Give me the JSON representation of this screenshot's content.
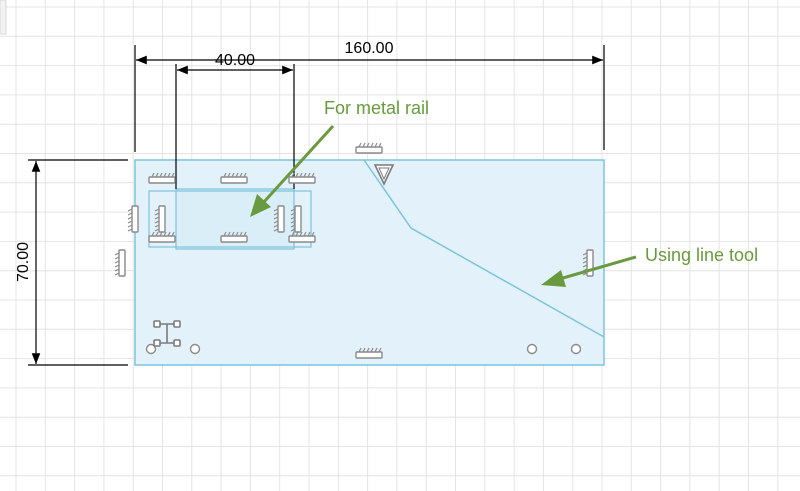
{
  "sketch": {
    "dimensions": {
      "overall_width": "160.00",
      "rail_width": "40.00",
      "height": "70.00"
    },
    "annotations": {
      "rail_note": "For metal rail",
      "line_note": "Using line tool"
    },
    "colors": {
      "annotation": "#6a9a3f",
      "sketch_line": "#7cc4dd",
      "profile_fill": "#e3f2fa",
      "grid": "#e4e4e4",
      "constraint_glyph": "#8a8a8a"
    },
    "constraint_icons": [
      "horizontal-constraint-icon",
      "vertical-constraint-icon",
      "coincident-point-icon",
      "midpoint-triangle-icon",
      "fix-constraint-icon"
    ]
  }
}
